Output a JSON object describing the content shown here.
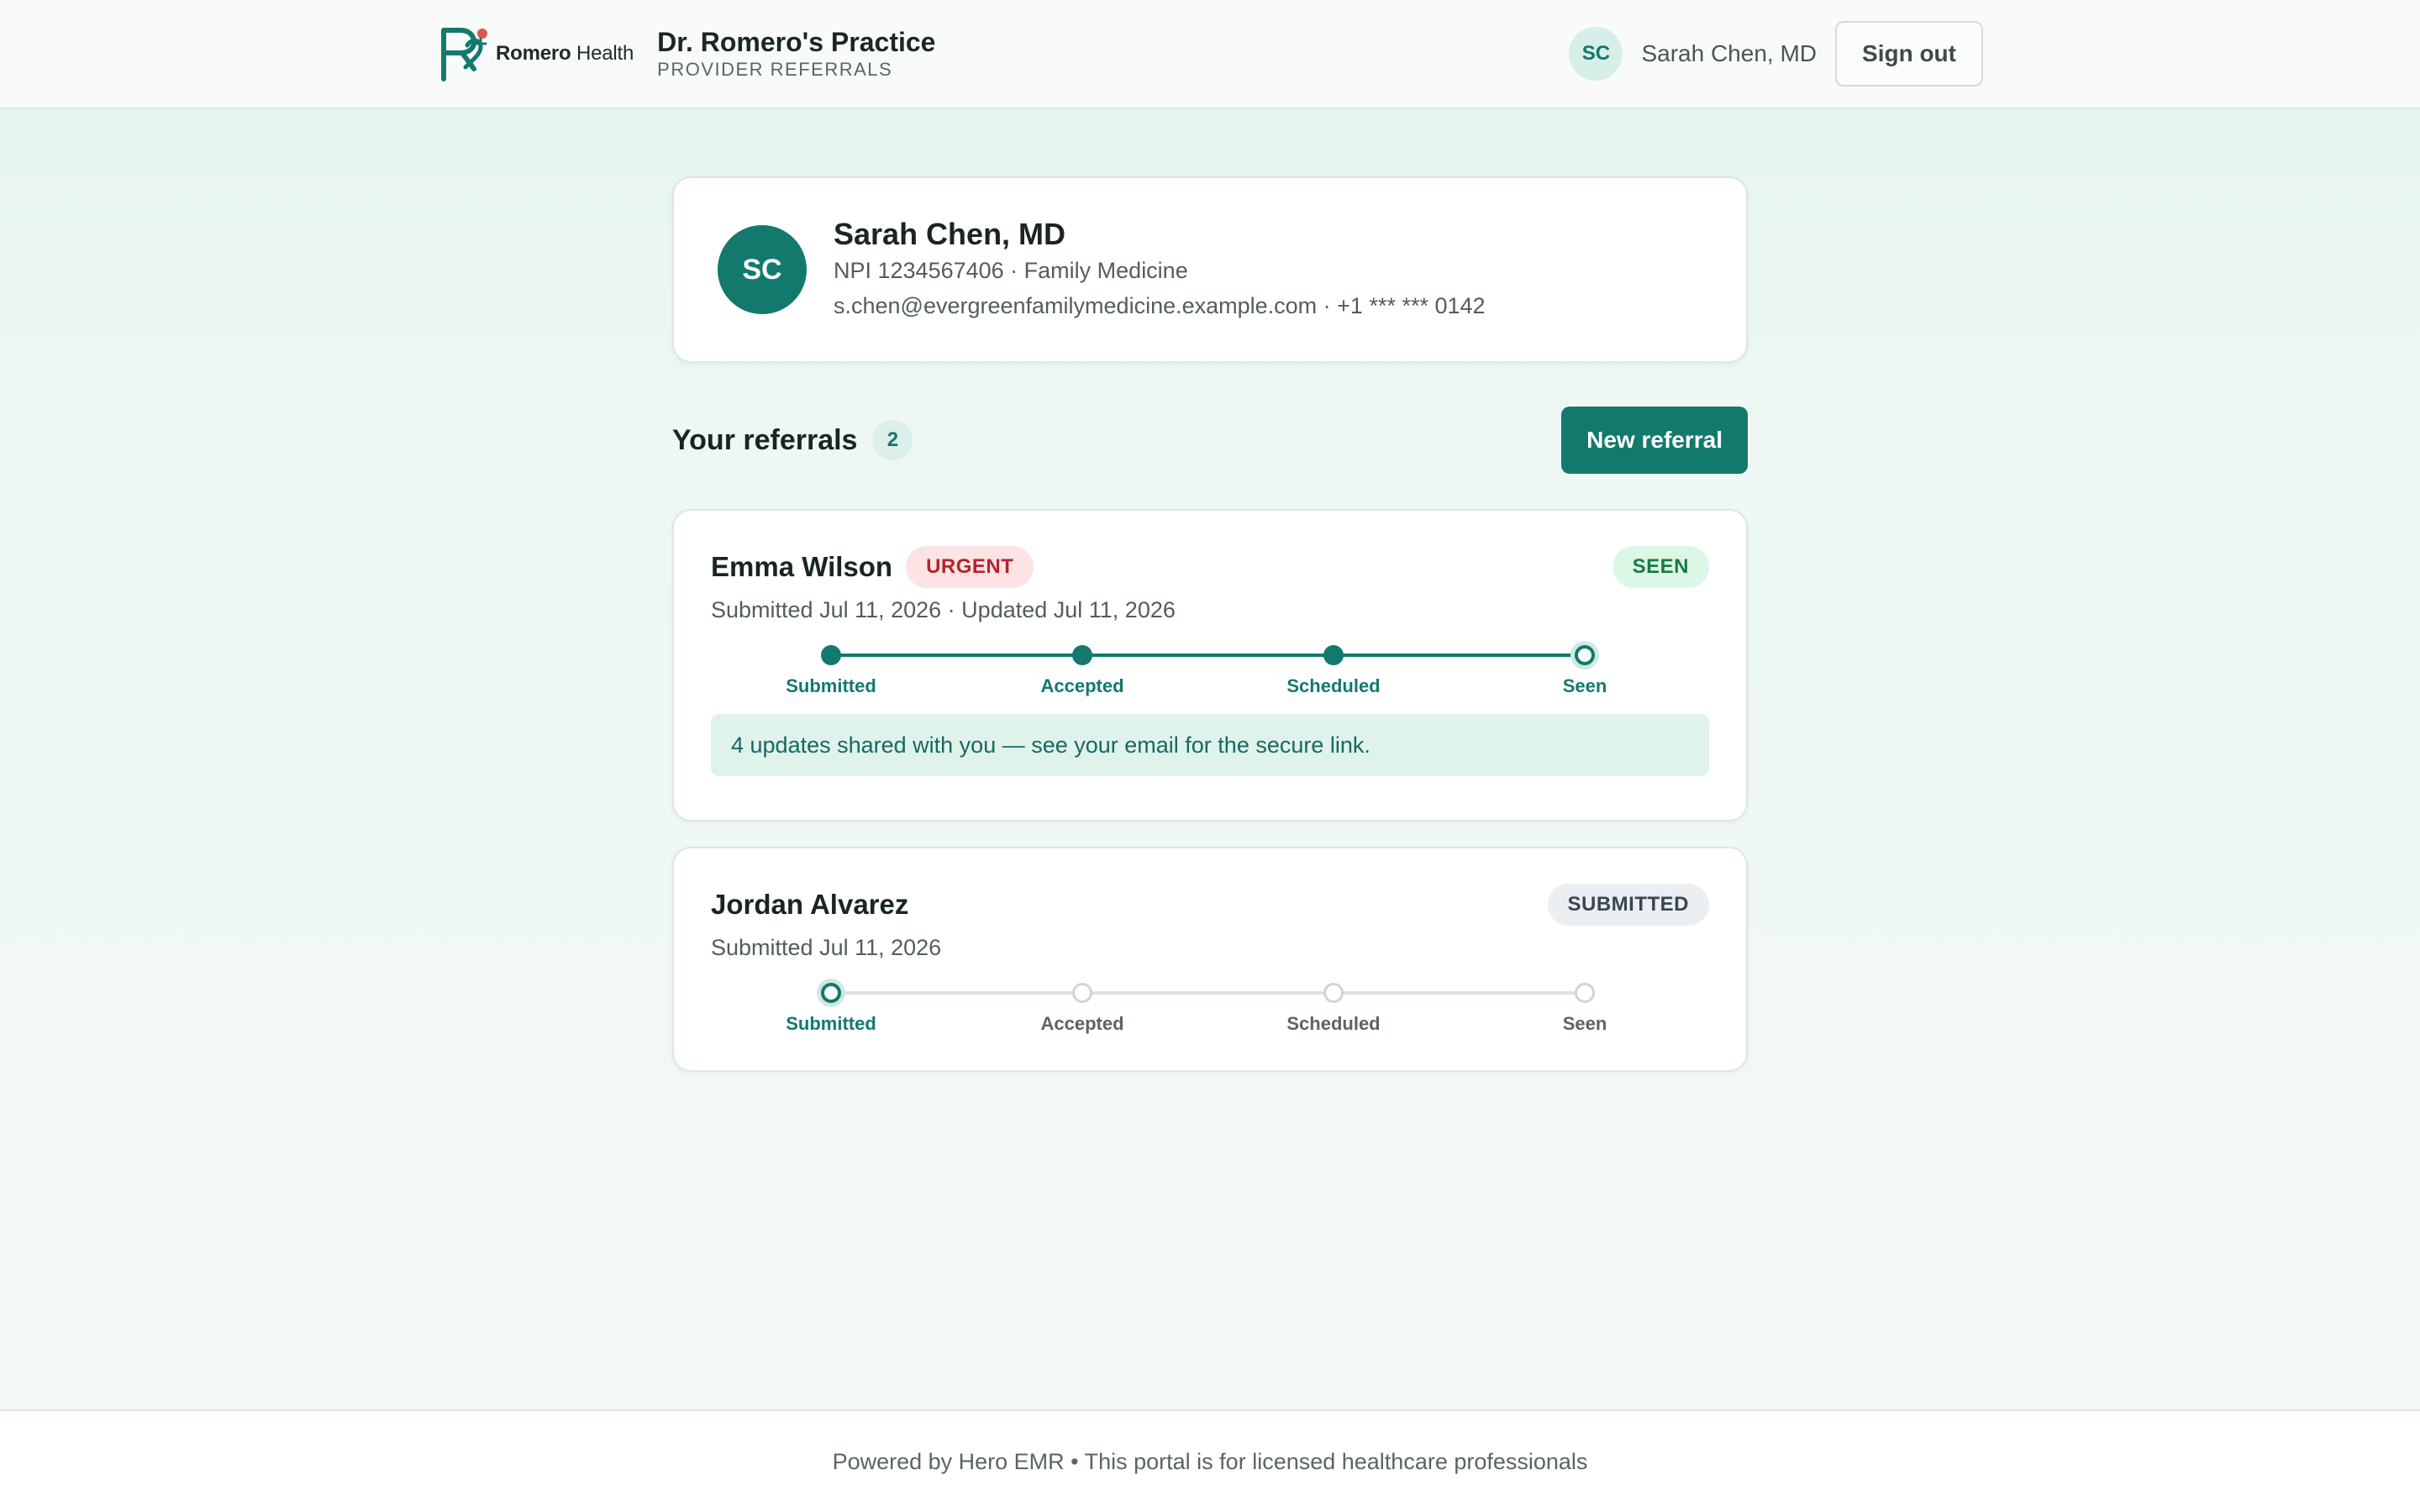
{
  "header": {
    "logo": {
      "brand_bold": "Romero",
      "brand_light": "Health"
    },
    "practice_name": "Dr. Romero's Practice",
    "practice_subtitle": "PROVIDER REFERRALS",
    "user": {
      "initials": "SC",
      "name": "Sarah Chen, MD"
    },
    "signout_label": "Sign out"
  },
  "provider": {
    "initials": "SC",
    "name": "Sarah Chen, MD",
    "npi_line": "NPI 1234567406 · Family Medicine",
    "contact_line": "s.chen@evergreenfamilymedicine.example.com · +1 *** *** 0142"
  },
  "referrals_section": {
    "title": "Your referrals",
    "count": "2",
    "new_button_label": "New referral"
  },
  "steps": [
    "Submitted",
    "Accepted",
    "Scheduled",
    "Seen"
  ],
  "referrals": [
    {
      "patient": "Emma Wilson",
      "priority": "URGENT",
      "status": "SEEN",
      "dates": "Submitted Jul 11, 2026 · Updated Jul 11, 2026",
      "current_step": 3,
      "notice": "4 updates shared with you — see your email for the secure link."
    },
    {
      "patient": "Jordan Alvarez",
      "status": "SUBMITTED",
      "dates": "Submitted Jul 11, 2026",
      "current_step": 0
    }
  ],
  "footer": {
    "text": "Powered by Hero EMR • This portal is for licensed healthcare professionals"
  },
  "colors": {
    "accent": "#13796d",
    "urgent": "#b3242e",
    "seen": "#1a7a45",
    "logo_dot": "#e2564f"
  },
  "icons": {
    "logo": "romero-health-logo-mark"
  }
}
